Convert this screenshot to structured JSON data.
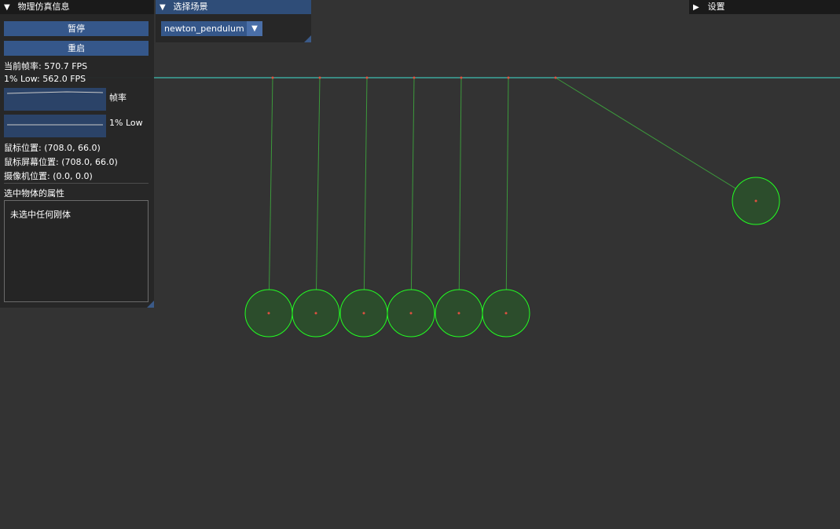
{
  "info_panel": {
    "title": "物理仿真信息",
    "pause_label": "暂停",
    "restart_label": "重启",
    "fps_text": "当前帧率: 570.7 FPS",
    "low_text": "1% Low: 562.0 FPS",
    "fps_plot_label": "帧率",
    "low_plot_label": "1% Low",
    "mouse_pos": "鼠标位置: (708.0, 66.0)",
    "mouse_screen_pos": "鼠标屏幕位置: (708.0, 66.0)",
    "camera_pos": "摄像机位置: (0.0, 0.0)",
    "selected_header": "选中物体的属性",
    "selected_empty": "未选中任何刚体"
  },
  "scene_panel": {
    "title": "选择场景",
    "selected_scene": "newton_pendulum"
  },
  "settings_panel": {
    "title": "设置"
  },
  "colors": {
    "background": "#333333",
    "ball_fill": "#2c4d2c",
    "ball_outline": "#22ff22",
    "rope": "#3c9a3c",
    "anchor_line": "#40e0d0",
    "pivot": "#e05040",
    "panel_accent": "#35578a"
  },
  "icons": {
    "collapse": "triangle-down-icon",
    "expand": "triangle-right-icon"
  },
  "simulation": {
    "scene": "newton_pendulum",
    "pendulums": [
      {
        "pivot": [
          347,
          99
        ],
        "bob": [
          342,
          399
        ]
      },
      {
        "pivot": [
          407,
          99
        ],
        "bob": [
          402,
          399
        ]
      },
      {
        "pivot": [
          467,
          99
        ],
        "bob": [
          463,
          399
        ]
      },
      {
        "pivot": [
          527,
          99
        ],
        "bob": [
          523,
          399
        ]
      },
      {
        "pivot": [
          587,
          99
        ],
        "bob": [
          584,
          399
        ]
      },
      {
        "pivot": [
          647,
          99
        ],
        "bob": [
          644,
          399
        ]
      },
      {
        "pivot": [
          707,
          99
        ],
        "bob": [
          962,
          256
        ]
      }
    ]
  }
}
